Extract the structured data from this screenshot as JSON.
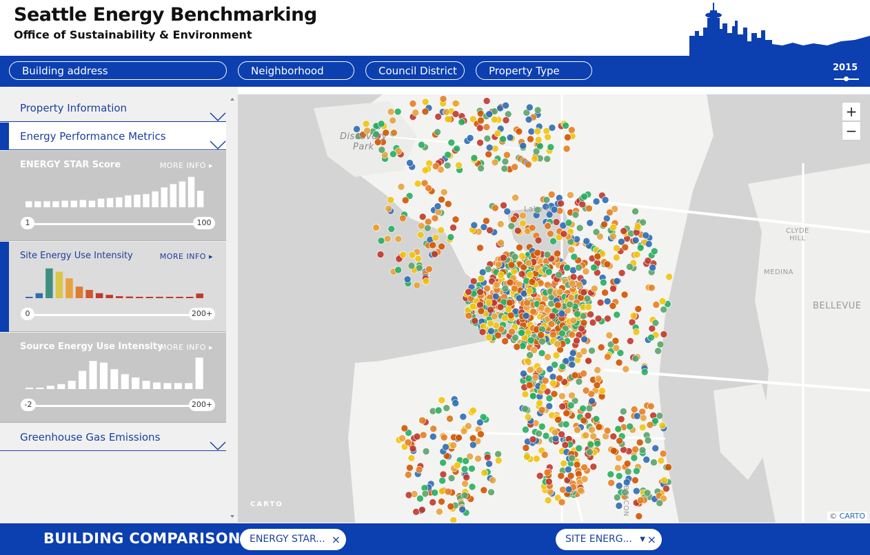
{
  "header": {
    "title": "Seattle Energy Benchmarking",
    "subtitle": "Office of Sustainability & Environment"
  },
  "nav": {
    "filters": [
      "Building address",
      "Neighborhood",
      "Council District",
      "Property Type"
    ],
    "year": "2015"
  },
  "sidebar": {
    "property_info": "Property Information",
    "energy_metrics": "Energy Performance Metrics",
    "ghg": "Greenhouse Gas Emissions",
    "metrics": [
      {
        "title": "ENERGY STAR Score",
        "more": "MORE INFO",
        "min": "1",
        "max": "100",
        "bars": [
          0.18,
          0.18,
          0.18,
          0.18,
          0.2,
          0.2,
          0.22,
          0.2,
          0.26,
          0.28,
          0.3,
          0.36,
          0.38,
          0.4,
          0.48,
          0.6,
          0.7,
          0.78,
          0.92,
          0.5
        ]
      },
      {
        "title": "Site Energy Use Intensity",
        "more": "MORE INFO",
        "min": "0",
        "max": "200+",
        "bars": [
          0.03,
          0.15,
          0.9,
          0.8,
          0.6,
          0.35,
          0.25,
          0.15,
          0.1,
          0.06,
          0.05,
          0.04,
          0.03,
          0.03,
          0.03,
          0.03,
          0.03,
          0.14
        ]
      },
      {
        "title": "Source Energy Use Intensity",
        "more": "MORE INFO",
        "min": "-2",
        "max": "200+",
        "bars": [
          0.02,
          0.04,
          0.1,
          0.15,
          0.25,
          0.55,
          0.85,
          0.8,
          0.6,
          0.45,
          0.35,
          0.25,
          0.2,
          0.18,
          0.18,
          0.18,
          0.95
        ]
      }
    ]
  },
  "map": {
    "labels": {
      "discovery": "Discovery\nPark",
      "clyde": "CLYDE\nHILL",
      "medina": "MEDINA",
      "bellevue": "BELLEVUE",
      "lake_union": "Lake U",
      "beacon": "BEACON"
    },
    "carto_logo": "CARTO",
    "attribution_symbol": "©",
    "attribution": "CARTO",
    "zoom_in": "+",
    "zoom_out": "−"
  },
  "bottom": {
    "title": "BUILDING COMPARISON",
    "chip1": "ENERGY STAR...",
    "chip2": "SITE ENERG...",
    "close": "×",
    "dropdown": "▼"
  },
  "colors": {
    "brand": "#0c3fb0",
    "dots": [
      "#c0392b",
      "#e67e22",
      "#f1c40f",
      "#2e6db4",
      "#5aa469",
      "#27ae60",
      "#e8a33c",
      "#d35400"
    ]
  },
  "icons": {
    "chevron": "chevron-down-icon",
    "triangle": "play-arrow-icon"
  }
}
